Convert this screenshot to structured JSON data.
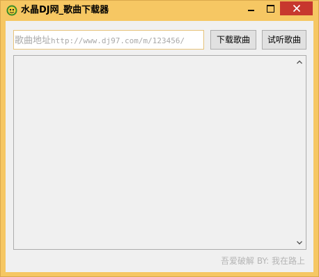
{
  "window": {
    "title": "水晶DJ网_歌曲下载器",
    "controls": {
      "minimize": "minimize-icon",
      "maximize": "maximize-icon",
      "close": "close-icon"
    },
    "colors": {
      "frame": "#f6c763",
      "close_button": "#c7372e"
    }
  },
  "form": {
    "url_prefix": "歌曲地址",
    "url_example": "http://www.dj97.com/m/123456/",
    "download_label": "下载歌曲",
    "preview_label": "试听歌曲"
  },
  "log": {
    "content": ""
  },
  "footer": {
    "credit": "吾爱破解 BY: 我在路上"
  }
}
